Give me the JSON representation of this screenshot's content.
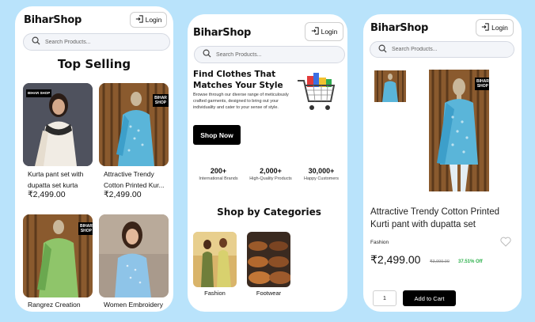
{
  "brand": "BiharShop",
  "login_label": "Login",
  "search_placeholder": "Search Products...",
  "screen1": {
    "section_title": "Top Selling",
    "products": [
      {
        "name": "Kurta pant set with dupatta set kurta",
        "price": "₹2,499.00",
        "badge": "BIHAR SHOP"
      },
      {
        "name": "Attractive Trendy Cotton Printed Kur...",
        "price": "₹2,499.00",
        "badge": "BIHAR SHOP"
      },
      {
        "name": "Rangrez Creation",
        "price": "",
        "badge": "BIHAR SHOP"
      },
      {
        "name": "Women Embroidery",
        "price": "",
        "badge": ""
      }
    ]
  },
  "screen2": {
    "hero_title": "Find Clothes That Matches Your Style",
    "hero_text": "Browse through our diverse range of meticulously crafted garments, designed to bring out your individuality and cater to your sense of style.",
    "shop_now": "Shop Now",
    "stats": [
      {
        "value": "200+",
        "label": "International Brands"
      },
      {
        "value": "2,000+",
        "label": "High-Quality Products"
      },
      {
        "value": "30,000+",
        "label": "Happy Customers"
      }
    ],
    "categories_title": "Shop by Categories",
    "categories": [
      {
        "label": "Fashion"
      },
      {
        "label": "Footwear"
      }
    ]
  },
  "screen3": {
    "badge": "BIHAR SHOP",
    "title": "Attractive Trendy Cotton Printed Kurti pant with dupatta set",
    "category": "Fashion",
    "price": "₹2,499.00",
    "old_price": "₹3,999.00",
    "discount": "37.51% Off",
    "quantity": "1",
    "add_to_cart": "Add to Cart"
  },
  "colors": {
    "background": "#b9e3fb",
    "accent": "#000000",
    "discount": "#2bb04a"
  },
  "icons": [
    "login-icon",
    "search-icon",
    "heart-icon",
    "shopping-cart-icon"
  ]
}
